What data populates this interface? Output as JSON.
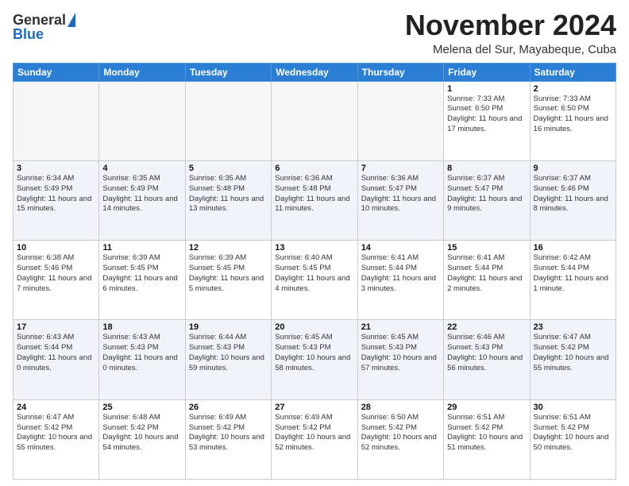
{
  "header": {
    "logo_line1": "General",
    "logo_line2": "Blue",
    "month_title": "November 2024",
    "location": "Melena del Sur, Mayabeque, Cuba"
  },
  "weekdays": [
    "Sunday",
    "Monday",
    "Tuesday",
    "Wednesday",
    "Thursday",
    "Friday",
    "Saturday"
  ],
  "weeks": [
    [
      {
        "day": "",
        "info": ""
      },
      {
        "day": "",
        "info": ""
      },
      {
        "day": "",
        "info": ""
      },
      {
        "day": "",
        "info": ""
      },
      {
        "day": "",
        "info": ""
      },
      {
        "day": "1",
        "info": "Sunrise: 7:33 AM\nSunset: 6:50 PM\nDaylight: 11 hours and 17 minutes."
      },
      {
        "day": "2",
        "info": "Sunrise: 7:33 AM\nSunset: 6:50 PM\nDaylight: 11 hours and 16 minutes."
      }
    ],
    [
      {
        "day": "3",
        "info": "Sunrise: 6:34 AM\nSunset: 5:49 PM\nDaylight: 11 hours and 15 minutes."
      },
      {
        "day": "4",
        "info": "Sunrise: 6:35 AM\nSunset: 5:49 PM\nDaylight: 11 hours and 14 minutes."
      },
      {
        "day": "5",
        "info": "Sunrise: 6:35 AM\nSunset: 5:48 PM\nDaylight: 11 hours and 13 minutes."
      },
      {
        "day": "6",
        "info": "Sunrise: 6:36 AM\nSunset: 5:48 PM\nDaylight: 11 hours and 11 minutes."
      },
      {
        "day": "7",
        "info": "Sunrise: 6:36 AM\nSunset: 5:47 PM\nDaylight: 11 hours and 10 minutes."
      },
      {
        "day": "8",
        "info": "Sunrise: 6:37 AM\nSunset: 5:47 PM\nDaylight: 11 hours and 9 minutes."
      },
      {
        "day": "9",
        "info": "Sunrise: 6:37 AM\nSunset: 5:46 PM\nDaylight: 11 hours and 8 minutes."
      }
    ],
    [
      {
        "day": "10",
        "info": "Sunrise: 6:38 AM\nSunset: 5:46 PM\nDaylight: 11 hours and 7 minutes."
      },
      {
        "day": "11",
        "info": "Sunrise: 6:39 AM\nSunset: 5:45 PM\nDaylight: 11 hours and 6 minutes."
      },
      {
        "day": "12",
        "info": "Sunrise: 6:39 AM\nSunset: 5:45 PM\nDaylight: 11 hours and 5 minutes."
      },
      {
        "day": "13",
        "info": "Sunrise: 6:40 AM\nSunset: 5:45 PM\nDaylight: 11 hours and 4 minutes."
      },
      {
        "day": "14",
        "info": "Sunrise: 6:41 AM\nSunset: 5:44 PM\nDaylight: 11 hours and 3 minutes."
      },
      {
        "day": "15",
        "info": "Sunrise: 6:41 AM\nSunset: 5:44 PM\nDaylight: 11 hours and 2 minutes."
      },
      {
        "day": "16",
        "info": "Sunrise: 6:42 AM\nSunset: 5:44 PM\nDaylight: 11 hours and 1 minute."
      }
    ],
    [
      {
        "day": "17",
        "info": "Sunrise: 6:43 AM\nSunset: 5:44 PM\nDaylight: 11 hours and 0 minutes."
      },
      {
        "day": "18",
        "info": "Sunrise: 6:43 AM\nSunset: 5:43 PM\nDaylight: 11 hours and 0 minutes."
      },
      {
        "day": "19",
        "info": "Sunrise: 6:44 AM\nSunset: 5:43 PM\nDaylight: 10 hours and 59 minutes."
      },
      {
        "day": "20",
        "info": "Sunrise: 6:45 AM\nSunset: 5:43 PM\nDaylight: 10 hours and 58 minutes."
      },
      {
        "day": "21",
        "info": "Sunrise: 6:45 AM\nSunset: 5:43 PM\nDaylight: 10 hours and 57 minutes."
      },
      {
        "day": "22",
        "info": "Sunrise: 6:46 AM\nSunset: 5:43 PM\nDaylight: 10 hours and 56 minutes."
      },
      {
        "day": "23",
        "info": "Sunrise: 6:47 AM\nSunset: 5:42 PM\nDaylight: 10 hours and 55 minutes."
      }
    ],
    [
      {
        "day": "24",
        "info": "Sunrise: 6:47 AM\nSunset: 5:42 PM\nDaylight: 10 hours and 55 minutes."
      },
      {
        "day": "25",
        "info": "Sunrise: 6:48 AM\nSunset: 5:42 PM\nDaylight: 10 hours and 54 minutes."
      },
      {
        "day": "26",
        "info": "Sunrise: 6:49 AM\nSunset: 5:42 PM\nDaylight: 10 hours and 53 minutes."
      },
      {
        "day": "27",
        "info": "Sunrise: 6:49 AM\nSunset: 5:42 PM\nDaylight: 10 hours and 52 minutes."
      },
      {
        "day": "28",
        "info": "Sunrise: 6:50 AM\nSunset: 5:42 PM\nDaylight: 10 hours and 52 minutes."
      },
      {
        "day": "29",
        "info": "Sunrise: 6:51 AM\nSunset: 5:42 PM\nDaylight: 10 hours and 51 minutes."
      },
      {
        "day": "30",
        "info": "Sunrise: 6:51 AM\nSunset: 5:42 PM\nDaylight: 10 hours and 50 minutes."
      }
    ]
  ]
}
